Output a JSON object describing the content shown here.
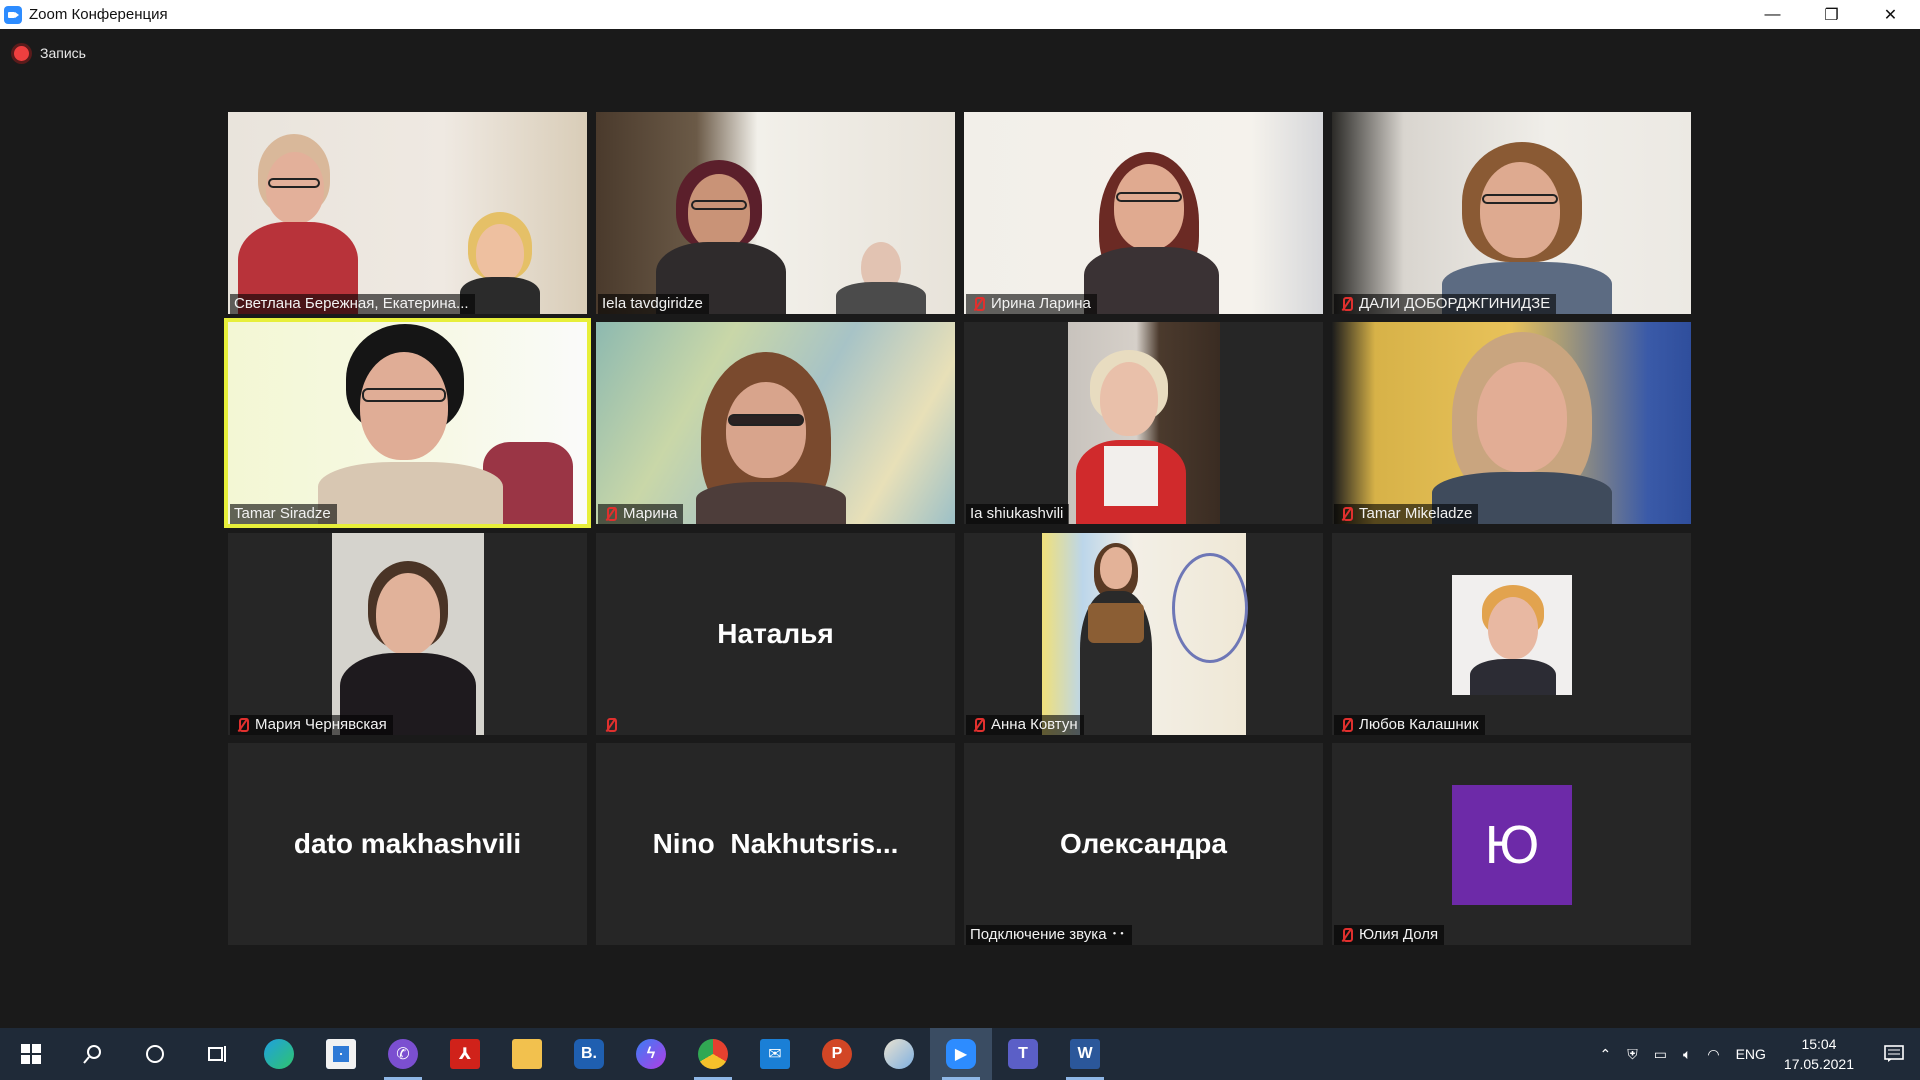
{
  "window": {
    "title": "Zoom Конференция",
    "minimize": "—",
    "restore": "❐",
    "close": "✕"
  },
  "recording": {
    "label": "Запись",
    "color": "#ef3f3f"
  },
  "participants": [
    {
      "name": "Светлана Бережная, Екатерина...",
      "muted": false,
      "video": true
    },
    {
      "name": "Iela tavdgiridze",
      "muted": false,
      "video": true
    },
    {
      "name": "Ирина Ларина",
      "muted": true,
      "video": true
    },
    {
      "name": "ДАЛИ ДОБОРДЖГИНИДЗЕ",
      "muted": true,
      "video": true
    },
    {
      "name": "Tamar Siradze",
      "muted": false,
      "video": true,
      "active_speaker": true
    },
    {
      "name": "Марина",
      "muted": true,
      "video": true
    },
    {
      "name": "Ia shiukashvili",
      "muted": false,
      "video": true
    },
    {
      "name": "Tamar Mikeladze",
      "muted": true,
      "video": true
    },
    {
      "name": "Мария Чернявская",
      "muted": true,
      "video": true
    },
    {
      "name": "",
      "display_name": "Наталья",
      "muted": true,
      "video": false
    },
    {
      "name": "Анна Ковтун",
      "muted": true,
      "video": true
    },
    {
      "name": "Любов Калашник",
      "muted": true,
      "video": true
    },
    {
      "name": "",
      "display_name": "dato makhashvili",
      "muted": false,
      "video": false
    },
    {
      "name": "",
      "display_name": "Nino  Nakhutsris...",
      "muted": false,
      "video": false
    },
    {
      "name": "Подключение звука ･･",
      "display_name": "Олександра",
      "muted": false,
      "video": false
    },
    {
      "name": "Юлия Доля",
      "avatar_letter": "Ю",
      "muted": true,
      "video": false
    }
  ],
  "taskbar": {
    "apps": [
      "start",
      "search-icon",
      "cortana",
      "task-view",
      "edge",
      "store",
      "viber",
      "acrobat",
      "file-explorer",
      "b-app",
      "messenger",
      "chrome",
      "mail",
      "powerpoint",
      "paint",
      "zoom",
      "teams",
      "word"
    ],
    "tray": {
      "lang": "ENG",
      "time": "15:04",
      "date": "17.05.2021"
    }
  },
  "colors": {
    "active_speaker_border": "#e7ef3a",
    "mute_icon": "#e0302e",
    "avatar_bg": "#6d2aa8",
    "taskbar": "#1f2a38"
  }
}
